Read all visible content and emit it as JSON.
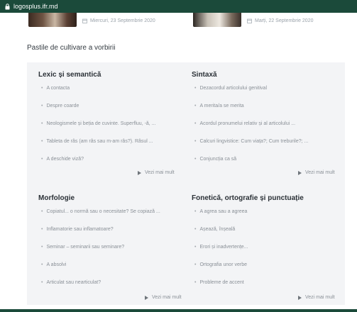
{
  "browser": {
    "url": "logosplus.ifr.md"
  },
  "articles": [
    {
      "date": "Miercuri, 23 Septembrie 2020"
    },
    {
      "date": "Marți, 22 Septembrie 2020"
    }
  ],
  "section": {
    "title": "Pastile de cultivare a vorbirii"
  },
  "categories": [
    {
      "title": "Lexic și semantică",
      "items": [
        "A contacta",
        "Despre coarde",
        "Neologismele și beția de cuvinte. Superfluu, -ă, ...",
        "Tableta de râs (am râs sau m-am râs?). Râsul ...",
        "A deschide viză?"
      ],
      "more": "Vezi mai mult"
    },
    {
      "title": "Sintaxă",
      "items": [
        "Dezacordul articolului genitival",
        "A merita/a se merita",
        "Acordul pronumelui relativ și al articolului ...",
        "Calcuri lingvistice: Cum viața?; Cum treburile?; ...",
        "Conjuncția ca să"
      ],
      "more": "Vezi mai mult"
    },
    {
      "title": "Morfologie",
      "items": [
        "Copiatul... o normă sau o necesitate? Se copiază ...",
        "Inflamatorie sau inflamatoare?",
        "Seminar – seminarii sau seminare?",
        "A absolvi",
        "Articulat sau nearticulat?"
      ],
      "more": "Vezi mai mult"
    },
    {
      "title": "Fonetică, ortografie și punctuație",
      "items": [
        "A agrea sau a agreea",
        "Așează, înșeală",
        "Erori și inadvertențe...",
        "Ortografia unor verbe",
        "Probleme de accent"
      ],
      "more": "Vezi mai mult"
    }
  ]
}
